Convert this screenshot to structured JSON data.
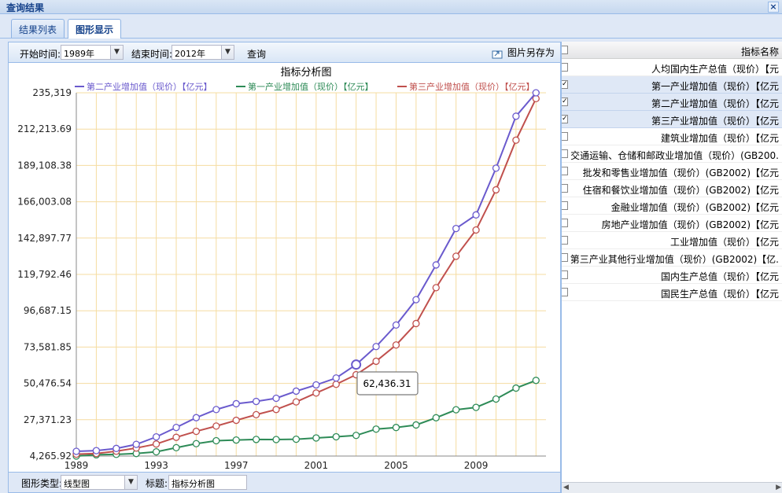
{
  "window": {
    "title": "查询结果",
    "close": "×"
  },
  "tabs": [
    {
      "label": "结果列表"
    },
    {
      "label": "图形显示"
    }
  ],
  "toolbar": {
    "start_label": "开始时间:",
    "start_value": "1989年",
    "end_label": "结束时间:",
    "end_value": "2012年",
    "query_label": "查询",
    "save_label": "图片另存为"
  },
  "bottom": {
    "type_label": "图形类型:",
    "type_value": "线型图",
    "title_label": "标题:",
    "title_value": "指标分析图"
  },
  "tooltip": "62,436.31",
  "panel": {
    "header": "指标名称",
    "items": [
      {
        "label": "人均国内生产总值（现价）【元",
        "checked": false
      },
      {
        "label": "第一产业增加值（现价）【亿元",
        "checked": true
      },
      {
        "label": "第二产业增加值（现价）【亿元",
        "checked": true
      },
      {
        "label": "第三产业增加值（现价）【亿元",
        "checked": true
      },
      {
        "label": "建筑业增加值（现价）【亿元",
        "checked": false
      },
      {
        "label": "交通运输、仓储和邮政业增加值（现价）(GB200.",
        "checked": false
      },
      {
        "label": "批发和零售业增加值（现价）(GB2002)【亿元",
        "checked": false
      },
      {
        "label": "住宿和餐饮业增加值（现价）(GB2002)【亿元",
        "checked": false
      },
      {
        "label": "金融业增加值（现价）(GB2002)【亿元",
        "checked": false
      },
      {
        "label": "房地产业增加值（现价）(GB2002)【亿元",
        "checked": false
      },
      {
        "label": "工业增加值（现价）【亿元",
        "checked": false
      },
      {
        "label": "第三产业其他行业增加值（现价）(GB2002)【亿.",
        "checked": false
      },
      {
        "label": "国内生产总值（现价）【亿元",
        "checked": false
      },
      {
        "label": "国民生产总值（现价）【亿元",
        "checked": false
      }
    ]
  },
  "chart_data": {
    "type": "line",
    "title": "指标分析图",
    "xlabel": "",
    "ylabel": "",
    "x": [
      1989,
      1990,
      1991,
      1992,
      1993,
      1994,
      1995,
      1996,
      1997,
      1998,
      1999,
      2000,
      2001,
      2002,
      2003,
      2004,
      2005,
      2006,
      2007,
      2008,
      2009,
      2010,
      2011,
      2012
    ],
    "xticks": [
      "1989",
      "1993",
      "1997",
      "2001",
      "2005",
      "2009"
    ],
    "yticks": [
      "4,265.92",
      "27,371.23",
      "50,476.54",
      "73,581.85",
      "96,687.15",
      "119,792.46",
      "142,897.77",
      "166,003.08",
      "189,108.38",
      "212,213.69",
      "235,319"
    ],
    "ylim": [
      4265.92,
      235319
    ],
    "legend_position": "top",
    "grid": true,
    "series": [
      {
        "name": "第二产业增加值（现价）【亿元】",
        "color": "#6a5acd",
        "values": [
          7278,
          7717,
          9102,
          11700,
          16454,
          22445,
          28679,
          33835,
          37543,
          39004,
          41033,
          45556,
          49512,
          53897,
          62436,
          73904,
          87598,
          103720,
          125831,
          149003,
          157639,
          187383,
          220413,
          235319
        ]
      },
      {
        "name": "第一产业增加值（现价）【亿元】",
        "color": "#2e8b57",
        "values": [
          4266,
          5062,
          5342,
          5867,
          6964,
          9573,
          12136,
          14015,
          14442,
          14817,
          14770,
          14945,
          15781,
          16537,
          17382,
          21413,
          22420,
          24040,
          28627,
          33702,
          35226,
          40534,
          47486,
          52374
        ]
      },
      {
        "name": "第三产业增加值（现价）【亿元】",
        "color": "#c0504d",
        "values": [
          5448,
          5888,
          7337,
          9357,
          11916,
          16180,
          19978,
          23326,
          26988,
          30580,
          33873,
          38714,
          44362,
          49899,
          56005,
          64561,
          74919,
          88555,
          111352,
          131340,
          148038,
          173596,
          205205,
          231626
        ]
      }
    ]
  }
}
